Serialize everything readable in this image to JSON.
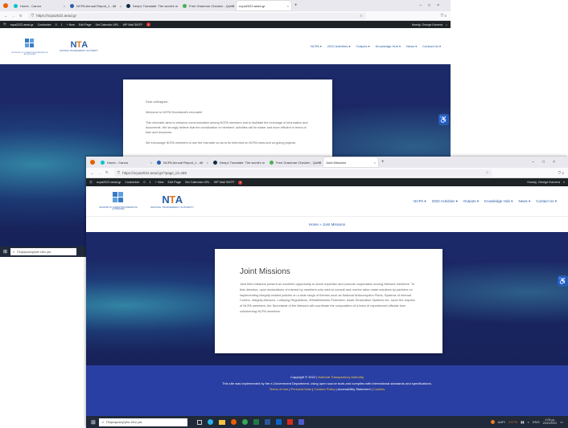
{
  "back_window": {
    "tabs": [
      {
        "label": "Home - Canva",
        "color": "#00c4cc"
      },
      {
        "label": "NCPA Annual Report_1 - All",
        "color": "#2b5ea8"
      },
      {
        "label": "DeepL Translate: The world's m",
        "color": "#0f2b46"
      },
      {
        "label": "Free Grammar Checker - QuillB",
        "color": "#4caf50"
      },
      {
        "label": "ncpa2022.aead.gr",
        "color": "#888888"
      }
    ],
    "url": "https://ncpa2022.aead.gr",
    "admin_items": [
      "ncpa2022.aead.gr",
      "Customize",
      "0",
      "1",
      "+ New",
      "Edit Page",
      "Set Calendar URL",
      "WP Mail SMTP"
    ],
    "admin_badge": "1",
    "admin_greeting": "Howdy, George Karvera",
    "menu": [
      "NCPA ▾",
      "2022 Activities ▾",
      "Outputs ▾",
      "Knowledge Hub ▾",
      "News ▾",
      "Contact Us ▾"
    ],
    "org_caption": "NETWORK OF CORRUPTION PREVENTION AUTHORITIES",
    "nta_caption": "NATIONAL TRANSPARENCY AUTHORITY",
    "card_paragraphs": [
      "Dear colleagues,",
      "Welcome to NCPA Secretariat's microsite!",
      "This microsite aims to enhance communication among NCPA members and to facilitate the exchange of information and documents. We strongly believe that the coordination of members' activities will be easier and more efficient in terms of time and resources.",
      "We encourage NCPA members to use the microsite so as to be informed on NCPA news and on-going projects."
    ],
    "search_placeholder": "Πληκτρολογήστε εδώ για"
  },
  "front_window": {
    "tabs": [
      {
        "label": "Home - Canva",
        "color": "#00c4cc"
      },
      {
        "label": "NCPA Annual Report_1 - All",
        "color": "#2b5ea8"
      },
      {
        "label": "DeepL Translate: The world's m",
        "color": "#0f2b46"
      },
      {
        "label": "Free Grammar Checker - QuillB",
        "color": "#4caf50"
      },
      {
        "label": "Joint Missions",
        "color": "#888888"
      }
    ],
    "url": "https://ncpa2022.aead.gr/?page_id=469",
    "admin_items": [
      "ncpa2022.aead.gr",
      "Customize",
      "0",
      "1",
      "+ New",
      "Edit Page",
      "Set Calendar URL",
      "WP Mail SMTP"
    ],
    "admin_badge": "1",
    "admin_greeting": "Howdy, George Karvera",
    "menu": [
      "NCPA ▾",
      "2022 Activities ▾",
      "Outputs ▾",
      "Knowledge Hub ▾",
      "News ▾",
      "Contact Us ▾"
    ],
    "org_caption": "NETWORK OF CORRUPTION PREVENTION AUTHORITIES",
    "nta_caption": "NATIONAL TRANSPARENCY AUTHORITY",
    "breadcrumb": "Home » Joint Missions",
    "card_title": "Joint Missions",
    "card_body": "Joint field missions present an excellent opportunity to share expertise and promote cooperation among Network members. To that direction, upon declarations of interest by members who wish to consult and receive tailor-made solutions by partners on implementing integrity-related policies on a wide range of themes such as National Anticorruption Plans, Systems of Internal Control, Integrity Advisors, Lobbying Regulations, Whistleblowers Protection, Asset Declaration Systems etc. Upon the request of NCPA members, the Secretariat of the Network will coordinate the composition of a team of experienced officials from volunteering NCPA members.",
    "footer_copyright": "Copyright © 2022 |",
    "footer_org": "National Transparency Authority",
    "footer_line2": "This site was implemented by the e-Government Department, using open source tools and complies with international standards and specifications.",
    "footer_links": [
      "Terms of Use",
      "Personal Data",
      "Cookies Policy",
      "Accessibility Statement",
      "Cookies"
    ],
    "search_placeholder": "Πληκτρολογήστε εδώ για",
    "tray": {
      "weather": "ΑΑΡΙ",
      "temp": "2.07%",
      "lang": "ENG",
      "time": "4:05 μμ",
      "date": "20/10/2022"
    }
  },
  "colors": {
    "accent": "#2b5ea8",
    "hero": "#1d2a6a",
    "footer": "#2a3fa3",
    "footer_link": "#f2c94c"
  }
}
